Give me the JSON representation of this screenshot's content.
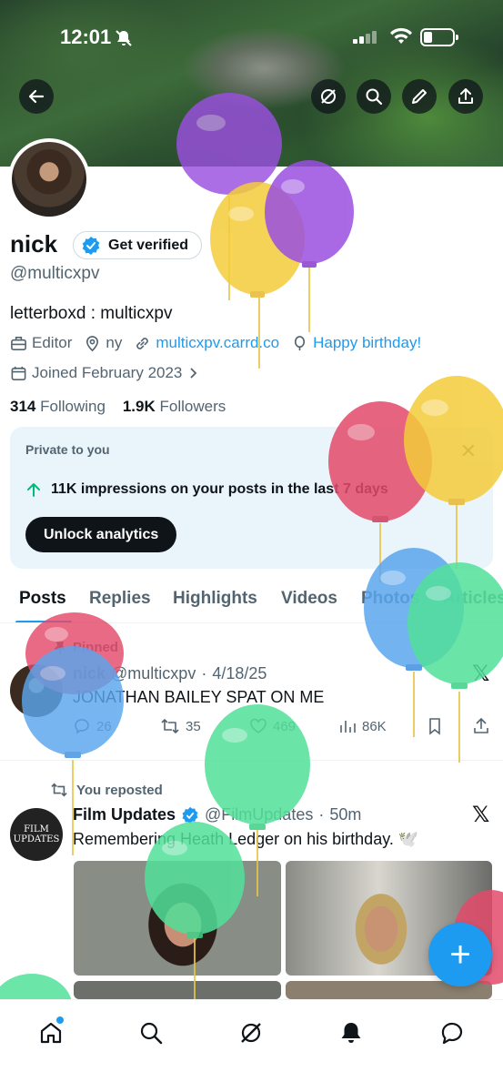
{
  "status_bar": {
    "time": "12:01"
  },
  "header_icons": [
    "back-arrow-icon",
    "grok-icon",
    "search-icon",
    "edit-icon",
    "share-icon"
  ],
  "profile": {
    "name": "nick",
    "get_verified_label": "Get verified",
    "handle": "@multicxpv",
    "bio": "letterboxd : multicxpv",
    "category": "Editor",
    "location": "ny",
    "website": "multicxpv.carrd.co",
    "birthday": "Happy birthday!",
    "joined": "Joined February 2023",
    "following_count": "314",
    "following_label": "Following",
    "followers_count": "1.9K",
    "followers_label": "Followers"
  },
  "private_card": {
    "title": "Private to you",
    "impressions_text": "11K impressions on your posts in the last 7 days",
    "button_label": "Unlock analytics"
  },
  "tabs": [
    "Posts",
    "Replies",
    "Highlights",
    "Videos",
    "Photos",
    "Articles"
  ],
  "active_tab": "Posts",
  "pinned_post": {
    "pinned_label": "Pinned",
    "author": "nick",
    "handle": "@multicxpv",
    "date": "4/18/25",
    "text": "JONATHAN BAILEY SPAT ON ME",
    "replies": "26",
    "reposts": "35",
    "likes": "469",
    "views": "86K"
  },
  "repost": {
    "reposted_label": "You reposted",
    "author": "Film Updates",
    "handle": "@FilmUpdates",
    "time": "50m",
    "text": "Remembering Heath Ledger on his birthday. 🕊️",
    "avatar_text_line1": "FILM",
    "avatar_text_line2": "UPDATES"
  },
  "fab_label": "+",
  "bottom_nav": [
    "home-icon",
    "search-icon",
    "grok-icon",
    "notifications-icon",
    "messages-icon"
  ],
  "colors": {
    "accent": "#1d9bf0",
    "text": "#0f1419",
    "muted": "#536471",
    "card_bg": "#eaf4fb"
  }
}
